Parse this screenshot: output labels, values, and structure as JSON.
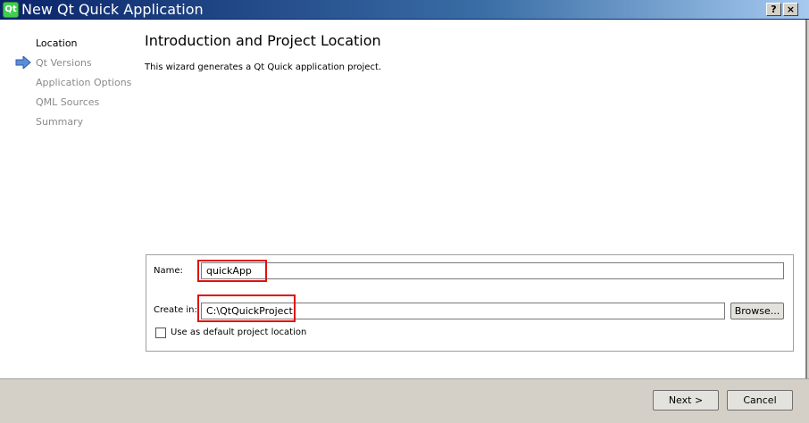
{
  "window": {
    "title": "New Qt Quick Application",
    "icon": "qt-logo-icon",
    "icon_text": "Qt",
    "help_label": "?",
    "close_label": "×"
  },
  "nav": {
    "active_icon": "right-arrow-icon",
    "items": [
      {
        "label": "Location",
        "active": true
      },
      {
        "label": "Qt Versions",
        "active": false
      },
      {
        "label": "Application Options",
        "active": false
      },
      {
        "label": "QML Sources",
        "active": false
      },
      {
        "label": "Summary",
        "active": false
      }
    ]
  },
  "page": {
    "title": "Introduction and Project Location",
    "description": "This wizard generates a Qt Quick application project."
  },
  "form": {
    "name_label": "Name:",
    "name_value": "quickApp",
    "create_in_label": "Create in:",
    "create_in_value": "C:\\QtQuickProject",
    "browse_label": "Browse...",
    "default_location_label": "Use as default project location",
    "default_location_checked": false
  },
  "footer": {
    "next_label": "Next >",
    "cancel_label": "Cancel"
  },
  "colors": {
    "title_bar_start": "#0a246a",
    "title_bar_end": "#a6caf0",
    "highlight": "#e01010",
    "nav_inactive": "#8a8a8a"
  }
}
